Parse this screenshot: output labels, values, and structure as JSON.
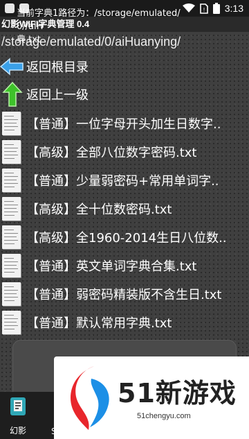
{
  "status_bar": {
    "time": "3:13"
  },
  "app": {
    "title": "幻影WIFI字典管理 0.4"
  },
  "path": "/storage/emulated/0/aiHuanying/",
  "nav": {
    "root": "返回根目录",
    "up": "返回上一级"
  },
  "files": [
    {
      "label": "【普通】一位字母开头加生日数字.."
    },
    {
      "label": "【高级】全部八位数字密码.txt"
    },
    {
      "label": "【普通】少量弱密码+常用单词字.."
    },
    {
      "label": "【高级】全十位数密码.txt"
    },
    {
      "label": "【高级】全1960-2014生日八位数.."
    },
    {
      "label": "【普通】英文单词字典合集.txt"
    },
    {
      "label": "【普通】弱密码精装版不含生日.txt"
    },
    {
      "label": "【普通】默认常用字典.txt"
    }
  ],
  "info": {
    "line1": "当前字典1路径为：/storage/emulated/",
    "line2": "0//aiH",
    "line3": "典.txt"
  },
  "tabs": [
    {
      "label": "幻影"
    },
    {
      "label": "SC"
    }
  ],
  "watermark": {
    "brand": "51新游戏",
    "url": "51chengyu.com"
  },
  "colors": {
    "arrow_blue": "#3aa0e8",
    "arrow_green": "#3ec22a",
    "logo_red": "#e8262c",
    "logo_blue": "#1c8fe6"
  }
}
